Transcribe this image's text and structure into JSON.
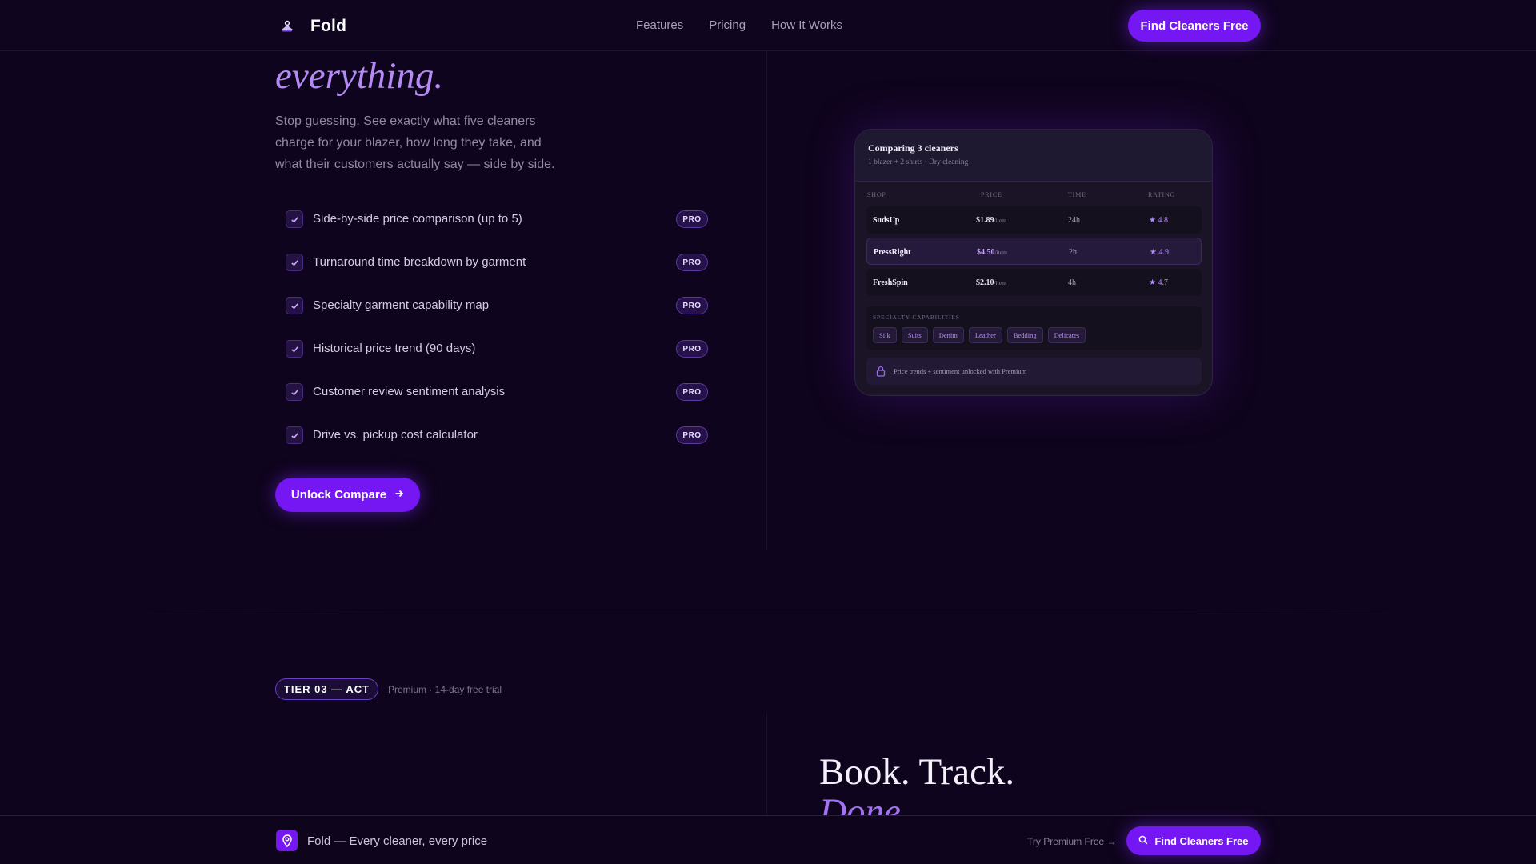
{
  "nav": {
    "brand": "Fold",
    "links": [
      "Features",
      "Pricing",
      "How It Works"
    ],
    "cta": "Find Cleaners Free"
  },
  "hero": {
    "headline_italic": "everything.",
    "subtitle": "Stop guessing. See exactly what five cleaners charge for your blazer, how long they take, and what their customers actually say — side by side.",
    "pro_label": "PRO",
    "features": [
      "Side-by-side price comparison (up to 5)",
      "Turnaround time breakdown by garment",
      "Specialty garment capability map",
      "Historical price trend (90 days)",
      "Customer review sentiment analysis",
      "Drive vs. pickup cost calculator"
    ],
    "cta": "Unlock Compare"
  },
  "compare_card": {
    "title": "Comparing 3 cleaners",
    "subtitle": "1 blazer + 2 shirts · Dry cleaning",
    "columns": [
      "SHOP",
      "PRICE",
      "TIME",
      "RATING"
    ],
    "unit": "/item",
    "rows": [
      {
        "shop": "SudsUp",
        "price": "$1.89",
        "time": "24h",
        "rating": "★ 4.8",
        "highlighted": false
      },
      {
        "shop": "PressRight",
        "price": "$4.50",
        "time": "2h",
        "rating": "★ 4.9",
        "highlighted": true
      },
      {
        "shop": "FreshSpin",
        "price": "$2.10",
        "time": "4h",
        "rating": "★ 4.7",
        "highlighted": false
      }
    ],
    "specialty_label": "SPECIALTY CAPABILITIES",
    "specialties": [
      "Silk",
      "Suits",
      "Denim",
      "Leather",
      "Bedding",
      "Delicates"
    ],
    "lock_note": "Price trends + sentiment unlocked with Premium"
  },
  "tier": {
    "badge": "TIER 03 — ACT",
    "note": "Premium · 14-day free trial",
    "headline_line1": "Book. Track.",
    "headline_line2": "Done."
  },
  "bottom_bar": {
    "text": "Fold — Every cleaner, every price",
    "try_link": "Try Premium Free →",
    "cta": "Find Cleaners Free"
  },
  "colors": {
    "background": "#0f041d",
    "accent": "#7417f2",
    "accent_light": "#b68af5"
  },
  "icons": [
    "hanger-icon",
    "check-icon",
    "arrow-right-icon",
    "lock-icon",
    "location-pin-icon",
    "search-icon"
  ]
}
